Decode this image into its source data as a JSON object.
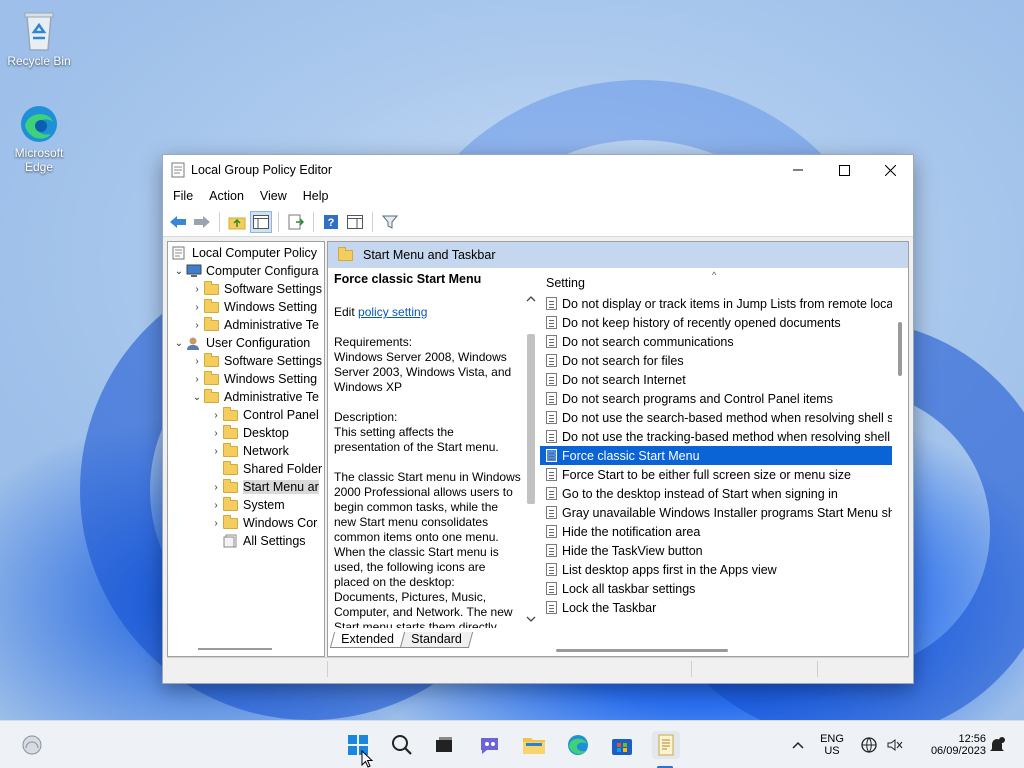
{
  "desktop": {
    "icons": [
      {
        "label": "Recycle Bin"
      },
      {
        "label": "Microsoft Edge"
      }
    ]
  },
  "window": {
    "title": "Local Group Policy Editor",
    "menu": [
      "File",
      "Action",
      "View",
      "Help"
    ]
  },
  "tree": {
    "items": [
      {
        "label": "Local Computer Policy"
      },
      {
        "label": "Computer Configura"
      },
      {
        "label": "Software Settings"
      },
      {
        "label": "Windows Setting"
      },
      {
        "label": "Administrative Te"
      },
      {
        "label": "User Configuration"
      },
      {
        "label": "Software Settings"
      },
      {
        "label": "Windows Setting"
      },
      {
        "label": "Administrative Te"
      },
      {
        "label": "Control Panel"
      },
      {
        "label": "Desktop"
      },
      {
        "label": "Network"
      },
      {
        "label": "Shared Folder"
      },
      {
        "label": "Start Menu ar"
      },
      {
        "label": "System"
      },
      {
        "label": "Windows Cor"
      },
      {
        "label": "All Settings"
      }
    ]
  },
  "header": {
    "title": "Start Menu and Taskbar"
  },
  "description": {
    "title": "Force classic Start Menu",
    "edit_prefix": "Edit",
    "edit_link": "policy setting",
    "requirements_label": "Requirements:",
    "requirements": "Windows Server 2008, Windows Server 2003, Windows Vista, and Windows XP",
    "description_label": "Description:",
    "description_text": "This setting affects the presentation of the Start menu.",
    "body": "The classic Start menu in Windows 2000 Professional allows users to begin common tasks, while the new Start menu consolidates common items onto one menu. When the classic Start menu is used, the following icons are placed on the desktop: Documents, Pictures, Music, Computer, and Network. The new Start menu starts them directly."
  },
  "settings": {
    "column_header": "Setting",
    "items": [
      "Do not display or track items in Jump Lists from remote loca...",
      "Do not keep history of recently opened documents",
      "Do not search communications",
      "Do not search for files",
      "Do not search Internet",
      "Do not search programs and Control Panel items",
      "Do not use the search-based method when resolving shell s...",
      "Do not use the tracking-based method when resolving shell ...",
      "Force classic Start Menu",
      "Force Start to be either full screen size or menu size",
      "Go to the desktop instead of Start when signing in",
      "Gray unavailable Windows Installer programs Start Menu sh...",
      "Hide the notification area",
      "Hide the TaskView button",
      "List desktop apps first in the Apps view",
      "Lock all taskbar settings",
      "Lock the Taskbar"
    ],
    "selected_index": 8
  },
  "tabs": [
    "Extended",
    "Standard"
  ],
  "taskbar": {
    "lang_top": "ENG",
    "lang_bottom": "US",
    "time": "12:56",
    "date": "06/09/2023"
  },
  "colors": {
    "selection": "#0a64d6",
    "header_band": "#c5d7ee",
    "link": "#0b57b5"
  }
}
